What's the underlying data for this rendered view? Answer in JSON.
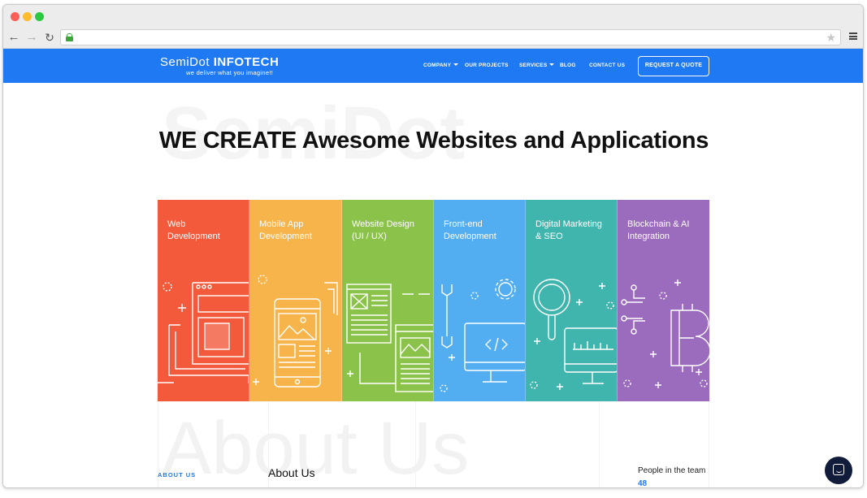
{
  "browser": {
    "url": "",
    "icons": [
      "back-icon",
      "forward-icon",
      "reload-icon",
      "lock-icon",
      "star-icon",
      "menu-icon"
    ]
  },
  "header": {
    "logo_thin": "SemiDot ",
    "logo_bold": "INFOTECH",
    "tagline": "we deliver what you imagine!!",
    "nav": [
      {
        "label": "COMPANY",
        "has_caret": true
      },
      {
        "label": "OUR PROJECTS",
        "has_caret": false
      },
      {
        "label": "SERVICES",
        "has_caret": true
      },
      {
        "label": "BLOG",
        "has_caret": false
      },
      {
        "label": "CONTACT US",
        "has_caret": false
      }
    ],
    "cta": "REQUEST A QUOTE",
    "bg_color": "#1e79f2"
  },
  "hero": {
    "watermark": "SemiDot",
    "title": "WE CREATE Awesome Websites and Applications"
  },
  "services": [
    {
      "line1": "Web",
      "line2": "Development",
      "color": "#f25a3b",
      "icon": "web-development-icon"
    },
    {
      "line1": "Mobile App",
      "line2": "Development",
      "color": "#f7b44a",
      "icon": "mobile-app-icon"
    },
    {
      "line1": "Website Design",
      "line2": "(UI / UX)",
      "color": "#8bc34a",
      "icon": "website-design-icon"
    },
    {
      "line1": "Front-end",
      "line2": "Development",
      "color": "#52aef0",
      "icon": "frontend-icon"
    },
    {
      "line1": "Digital Marketing",
      "line2": "& SEO",
      "color": "#3fb5ad",
      "icon": "digital-marketing-icon"
    },
    {
      "line1": "Blockchain & AI",
      "line2": "Integration",
      "color": "#9b6bbd",
      "icon": "blockchain-icon"
    }
  ],
  "about": {
    "watermark": "About Us",
    "label": "ABOUT US",
    "heading": "About Us",
    "people_label": "People in the team",
    "people_count": "48"
  },
  "chat": {
    "icon": "chat-icon"
  }
}
